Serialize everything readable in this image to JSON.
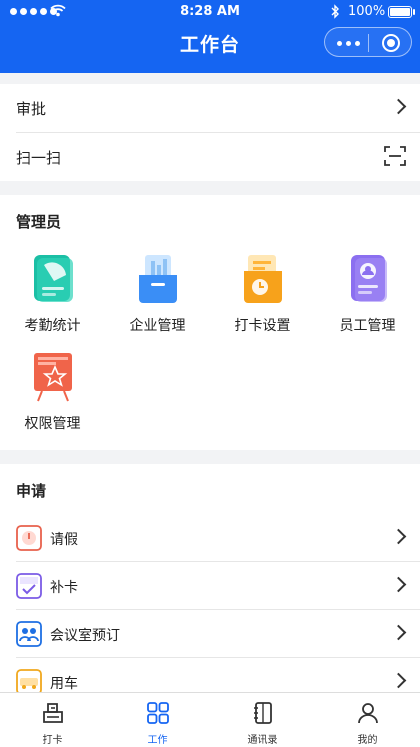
{
  "status_bar": {
    "time": "8:28 AM",
    "battery": "100%"
  },
  "header": {
    "title": "工作台"
  },
  "top_menu": [
    {
      "label": "审批"
    },
    {
      "label": "扫一扫"
    }
  ],
  "admin": {
    "title": "管理员",
    "items": [
      {
        "label": "考勤统计",
        "icon": "attendance-stats-icon"
      },
      {
        "label": "企业管理",
        "icon": "enterprise-management-icon"
      },
      {
        "label": "打卡设置",
        "icon": "clock-in-settings-icon"
      },
      {
        "label": "员工管理",
        "icon": "employee-management-icon"
      },
      {
        "label": "权限管理",
        "icon": "permission-management-icon"
      }
    ]
  },
  "apply": {
    "title": "申请",
    "items": [
      {
        "label": "请假",
        "icon": "leave-icon",
        "color": "#e8614c"
      },
      {
        "label": "补卡",
        "icon": "makeup-clock-icon",
        "color": "#7b5be6"
      },
      {
        "label": "会议室预订",
        "icon": "meeting-room-icon",
        "color": "#1e6fe3"
      },
      {
        "label": "用车",
        "icon": "car-icon",
        "color": "#f0a81d"
      }
    ]
  },
  "tabbar": [
    {
      "label": "打卡",
      "icon": "clock-in-icon",
      "active": false
    },
    {
      "label": "工作",
      "icon": "work-grid-icon",
      "active": true
    },
    {
      "label": "通讯录",
      "icon": "contacts-icon",
      "active": false
    },
    {
      "label": "我的",
      "icon": "profile-icon",
      "active": false
    }
  ],
  "colors": {
    "brand": "#1565f2",
    "background": "#f2f3f5"
  }
}
